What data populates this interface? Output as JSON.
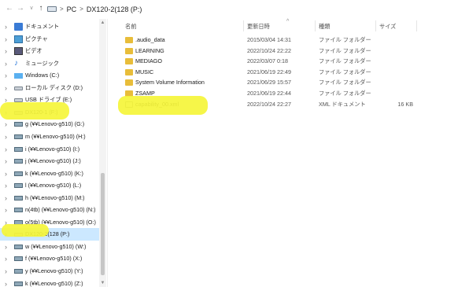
{
  "address_bar": {
    "back_glyph": "←",
    "forward_glyph": "→",
    "recent_glyph": "∨",
    "up_glyph": "↑",
    "sep_glyph": ">",
    "breadcrumbs": [
      "PC",
      "DX120-2(128 (P:)"
    ]
  },
  "sidebar": {
    "items": [
      {
        "label": "ドキュメント",
        "icon": "documents-folder-icon"
      },
      {
        "label": "ピクチャ",
        "icon": "pictures-folder-icon"
      },
      {
        "label": "ビデオ",
        "icon": "videos-folder-icon"
      },
      {
        "label": "ミュージック",
        "icon": "music-icon"
      },
      {
        "label": "Windows (C:)",
        "icon": "windows-drive-icon"
      },
      {
        "label": "ローカル ディスク (D:)",
        "icon": "drive-icon"
      },
      {
        "label": "USB ドライブ (E:)",
        "icon": "drive-icon"
      },
      {
        "label": "DX120-1 (F:)",
        "icon": "drive-icon"
      },
      {
        "label": "g (¥¥Lenovo-g510) (G:)",
        "icon": "network-drive-icon"
      },
      {
        "label": "m (¥¥Lenovo-g510) (H:)",
        "icon": "network-drive-icon"
      },
      {
        "label": "i (¥¥Lenovo-g510) (I:)",
        "icon": "network-drive-icon"
      },
      {
        "label": "j (¥¥Lenovo-g510) (J:)",
        "icon": "network-drive-icon"
      },
      {
        "label": "k (¥¥Lenovo-g510) (K:)",
        "icon": "network-drive-icon"
      },
      {
        "label": "l (¥¥Lenovo-g510) (L:)",
        "icon": "network-drive-icon"
      },
      {
        "label": "h (¥¥Lenovo-g510) (M:)",
        "icon": "network-drive-icon"
      },
      {
        "label": "n(4tb) (¥¥Lenovo-g510) (N:)",
        "icon": "network-drive-icon"
      },
      {
        "label": "o(5tb) (¥¥Lenovo-g510) (O:)",
        "icon": "network-drive-icon"
      },
      {
        "label": "DX120-2(128 (P:)",
        "icon": "drive-icon",
        "selected": true
      },
      {
        "label": "w (¥¥Lenovo-g510) (W:)",
        "icon": "network-drive-icon"
      },
      {
        "label": "f (¥¥Lenovo-g510) (X:)",
        "icon": "network-drive-icon"
      },
      {
        "label": "y (¥¥Lenovo-g510) (Y:)",
        "icon": "network-drive-icon"
      },
      {
        "label": "k (¥¥Lenovo-g510) (Z:)",
        "icon": "network-drive-icon"
      }
    ]
  },
  "file_list": {
    "columns": {
      "name": "名前",
      "date": "更新日時",
      "type": "種類",
      "size": "サイズ"
    },
    "sort_indicator": "^",
    "rows": [
      {
        "name": ".audio_data",
        "date": "2015/03/04 14:31",
        "type": "ファイル フォルダー",
        "size": "",
        "icon": "folder-icon"
      },
      {
        "name": "LEARNING",
        "date": "2022/10/24 22:22",
        "type": "ファイル フォルダー",
        "size": "",
        "icon": "folder-icon"
      },
      {
        "name": "MEDIAGO",
        "date": "2022/03/07 0:18",
        "type": "ファイル フォルダー",
        "size": "",
        "icon": "folder-icon"
      },
      {
        "name": "MUSIC",
        "date": "2021/06/19 22:49",
        "type": "ファイル フォルダー",
        "size": "",
        "icon": "folder-icon"
      },
      {
        "name": "System Volume Information",
        "date": "2021/06/29 15:57",
        "type": "ファイル フォルダー",
        "size": "",
        "icon": "folder-icon"
      },
      {
        "name": "ZSAMP",
        "date": "2021/06/19 22:44",
        "type": "ファイル フォルダー",
        "size": "",
        "icon": "folder-icon"
      },
      {
        "name": "capability_00.xml",
        "date": "2022/10/24 22:27",
        "type": "XML ドキュメント",
        "size": "16 KB",
        "icon": "xml-file-icon"
      }
    ]
  },
  "colors": {
    "highlighter": "#f5f53a",
    "selection": "#cce8ff"
  }
}
